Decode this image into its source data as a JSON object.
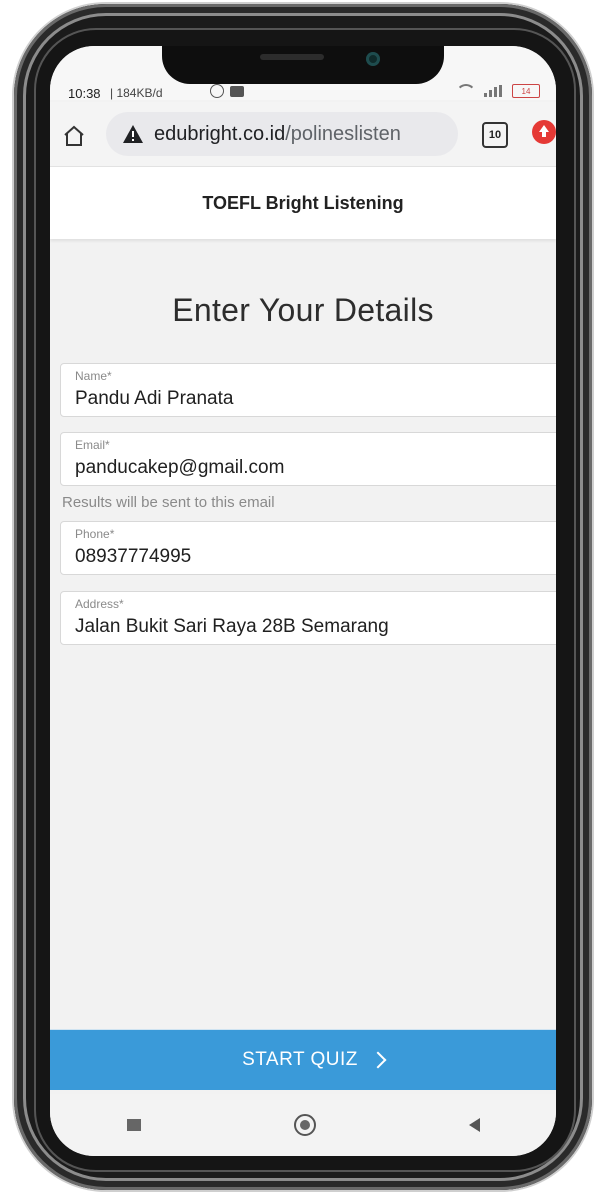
{
  "status_bar": {
    "time": "10:38",
    "data_rate": "| 184KB/d",
    "battery": "14"
  },
  "browser": {
    "url_domain": "edubright.co.id",
    "url_path": "/polineslisten",
    "tabs_count": "10"
  },
  "page": {
    "header_title": "TOEFL Bright Listening",
    "title": "Enter Your Details"
  },
  "form": {
    "name": {
      "label": "Name*",
      "value": "Pandu Adi Pranata"
    },
    "email": {
      "label": "Email*",
      "value": "panducakep@gmail.com"
    },
    "email_helper": "Results will be sent to this email",
    "phone": {
      "label": "Phone*",
      "value": "08937774995"
    },
    "address": {
      "label": "Address*",
      "value": "Jalan Bukit Sari Raya 28B Semarang"
    }
  },
  "actions": {
    "start_label": "START QUIZ"
  },
  "colors": {
    "accent": "#3a9ad9",
    "menu_icon": "#e53935"
  }
}
